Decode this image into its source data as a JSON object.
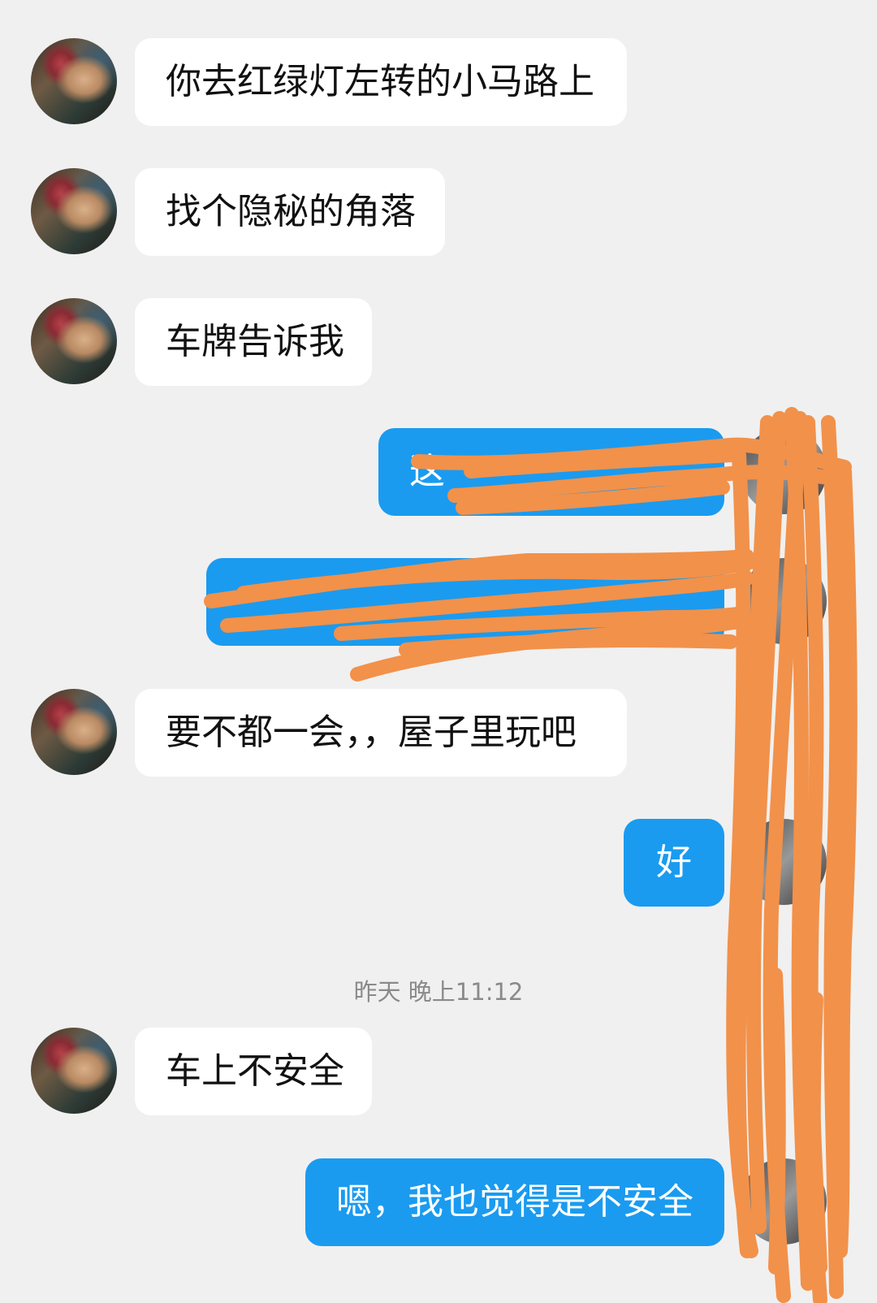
{
  "messages": [
    {
      "side": "left",
      "text": "你去红绿灯左转的小马路上"
    },
    {
      "side": "left",
      "text": "找个隐秘的角落"
    },
    {
      "side": "left",
      "text": "车牌告诉我"
    },
    {
      "side": "right",
      "text": "这"
    },
    {
      "side": "right",
      "text": ""
    },
    {
      "side": "left",
      "text": "要不都一会，，屋子里玩吧"
    },
    {
      "side": "right",
      "text": "好"
    },
    {
      "side": "left",
      "text": "车上不安全"
    },
    {
      "side": "right",
      "text": "嗯，我也觉得是不安全"
    }
  ],
  "timestamp": "昨天 晚上11:12",
  "colors": {
    "background": "#f0f0f0",
    "right_bubble": "#1a9bf0",
    "left_bubble": "#ffffff",
    "redaction": "#f2914a"
  }
}
